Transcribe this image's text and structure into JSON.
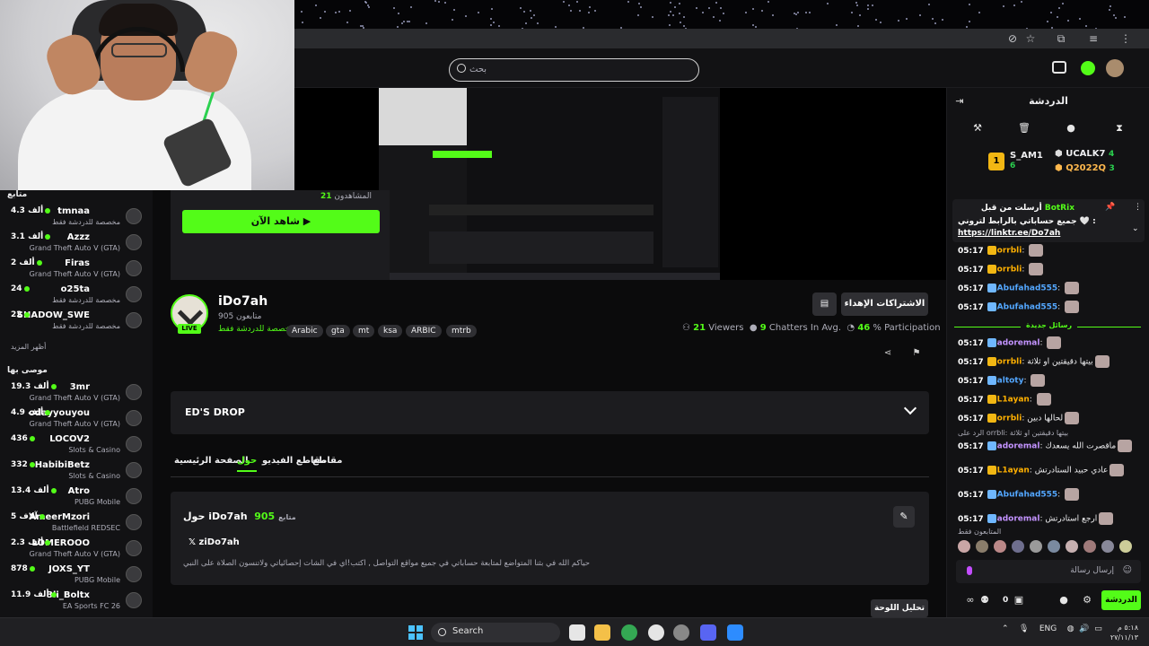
{
  "search": {
    "placeholder": "بحث"
  },
  "left_sidebar": {
    "following_title": "متابع",
    "following": [
      {
        "name": "tmnaa",
        "sub": "مخصصة للدردشة فقط",
        "count": "4.3 ألف"
      },
      {
        "name": "Azzz",
        "sub": "Grand Theft Auto V (GTA)",
        "count": "3.1 ألف"
      },
      {
        "name": "Firas",
        "sub": "Grand Theft Auto V (GTA)",
        "count": "2 ألف"
      },
      {
        "name": "o25ta",
        "sub": "مخصصة للدردشة فقط",
        "count": "24"
      },
      {
        "name": "SHADOW_SWE",
        "sub": "مخصصة للدردشة فقط",
        "count": "22"
      }
    ],
    "show_more": "أظهر المزيد",
    "recommended_title": "موصى بها",
    "recommended": [
      {
        "name": "3mr",
        "sub": "Grand Theft Auto V (GTA)",
        "count": "19.3 ألف"
      },
      {
        "name": "odayyouyou",
        "sub": "Grand Theft Auto V (GTA)",
        "count": "4.9 ألف"
      },
      {
        "name": "LOCOV2",
        "sub": "Slots & Casino",
        "count": "436"
      },
      {
        "name": "HabibiBetz",
        "sub": "Slots & Casino",
        "count": "332"
      },
      {
        "name": "Atro",
        "sub": "PUBG Mobile",
        "count": "13.4 ألف"
      },
      {
        "name": "AmeerMzori",
        "sub": "Battlefield REDSEC",
        "count": "5 آلاف"
      },
      {
        "name": "LOMEROOO",
        "sub": "Grand Theft Auto V (GTA)",
        "count": "2.3 ألف"
      },
      {
        "name": "JOXS_YT",
        "sub": "PUBG Mobile",
        "count": "878"
      },
      {
        "name": "3li_Boltx",
        "sub": "EA Sports FC 26",
        "count": "11.9 ألف"
      }
    ]
  },
  "offline_card": {
    "viewers_label": "المشاهدون",
    "viewers_value": "21",
    "watch_label": "شاهد الآن ▶"
  },
  "channel": {
    "name": "iDo7ah",
    "followers": "905 متابعون",
    "category": "مخصصة للدردشة فقط",
    "live": "LIVE",
    "tags": [
      "Arabic",
      "gta",
      "mt",
      "ksa",
      "ARBIC",
      "mtrb"
    ],
    "subscribe_label": "الاشتراكات الإهداء",
    "stats": {
      "viewers": "21",
      "viewers_label": "Viewers",
      "chatters": "9",
      "chatters_label": "Chatters In Avg.",
      "participation": "46",
      "participation_label": "% Participation"
    }
  },
  "drops": {
    "title": "ED'S DROP"
  },
  "tabs": [
    "الصفحة الرئيسية",
    "حول",
    "مقاطع الفيديو",
    "مقاطع"
  ],
  "about": {
    "title_prefix": "حول iDo7ah",
    "followers_count": "905",
    "followers_label": "متابع",
    "x_handle": "ziDo7ah",
    "bio": "حياكم الله في بثنا المتواضع لمتابعة حساباتي في جميع مواقع التواصل , اكتب!اي في الشات إحصائياتي ولاتنسون الصلاة على النبي"
  },
  "clip_button": "تحليل اللوحة",
  "chat": {
    "title": "الدردشة",
    "leaderboard": [
      {
        "name": "UCALK7",
        "n": "4"
      },
      {
        "name": "S_AM1",
        "n": "6"
      },
      {
        "name": "Q2022Q",
        "n": "3"
      }
    ],
    "pinned": {
      "author": "BotRix",
      "sent_by": "أرسلت من قبل",
      "message": "جميع حساباتي بالرابط لتروني 🤍 :",
      "link": "https://linktr.ee/Do7ah"
    },
    "messages": [
      {
        "time": "05:17",
        "user": "orrbli",
        "color": "#ffb000",
        "text": ""
      },
      {
        "time": "05:17",
        "user": "orrbli",
        "color": "#ffb000",
        "text": ""
      },
      {
        "time": "05:17",
        "user": "Abufahad555",
        "color": "#53a7ff",
        "text": ""
      },
      {
        "time": "05:17",
        "user": "Abufahad555",
        "color": "#53a7ff",
        "text": ""
      }
    ],
    "new_messages_label": "رسائل جديدة",
    "messages2": [
      {
        "time": "05:17",
        "user": "adoremal",
        "color": "#c393ff",
        "text": ""
      },
      {
        "time": "05:17",
        "user": "orrbli",
        "color": "#ffb000",
        "text": "بيتها دقيقتين او ثلاثة"
      },
      {
        "time": "05:17",
        "user": "altoty",
        "color": "#53a7ff",
        "text": ""
      },
      {
        "time": "05:17",
        "user": "L1ayan",
        "color": "#ffb000",
        "text": ""
      },
      {
        "time": "05:17",
        "user": "orrbli",
        "color": "#ffb000",
        "text": "لحالها دبين"
      }
    ],
    "reply_line": "الرد على orrbli: بيتها دقيقتين او ثلاثة",
    "messages3": [
      {
        "time": "05:17",
        "user": "adoremal",
        "color": "#c393ff",
        "text": "ماقصرت الله يسعدك"
      },
      {
        "time": "05:17",
        "user": "L1ayan",
        "color": "#ffb000",
        "text": "عادي حبيد الستادرتش"
      },
      {
        "time": "05:17",
        "user": "Abufahad555",
        "color": "#53a7ff",
        "text": ""
      },
      {
        "time": "05:17",
        "user": "adoremal",
        "color": "#c393ff",
        "text": "ارجع استادرتش"
      }
    ],
    "followers_only": "المتابعون فقط",
    "input_placeholder": "إرسال رسالة",
    "send_label": "الدردشة",
    "bottom_count": "0"
  },
  "taskbar": {
    "search": "Search",
    "lang": "ENG",
    "time": "٥:١٨ م",
    "date": "٢٧/١١/١٣"
  }
}
